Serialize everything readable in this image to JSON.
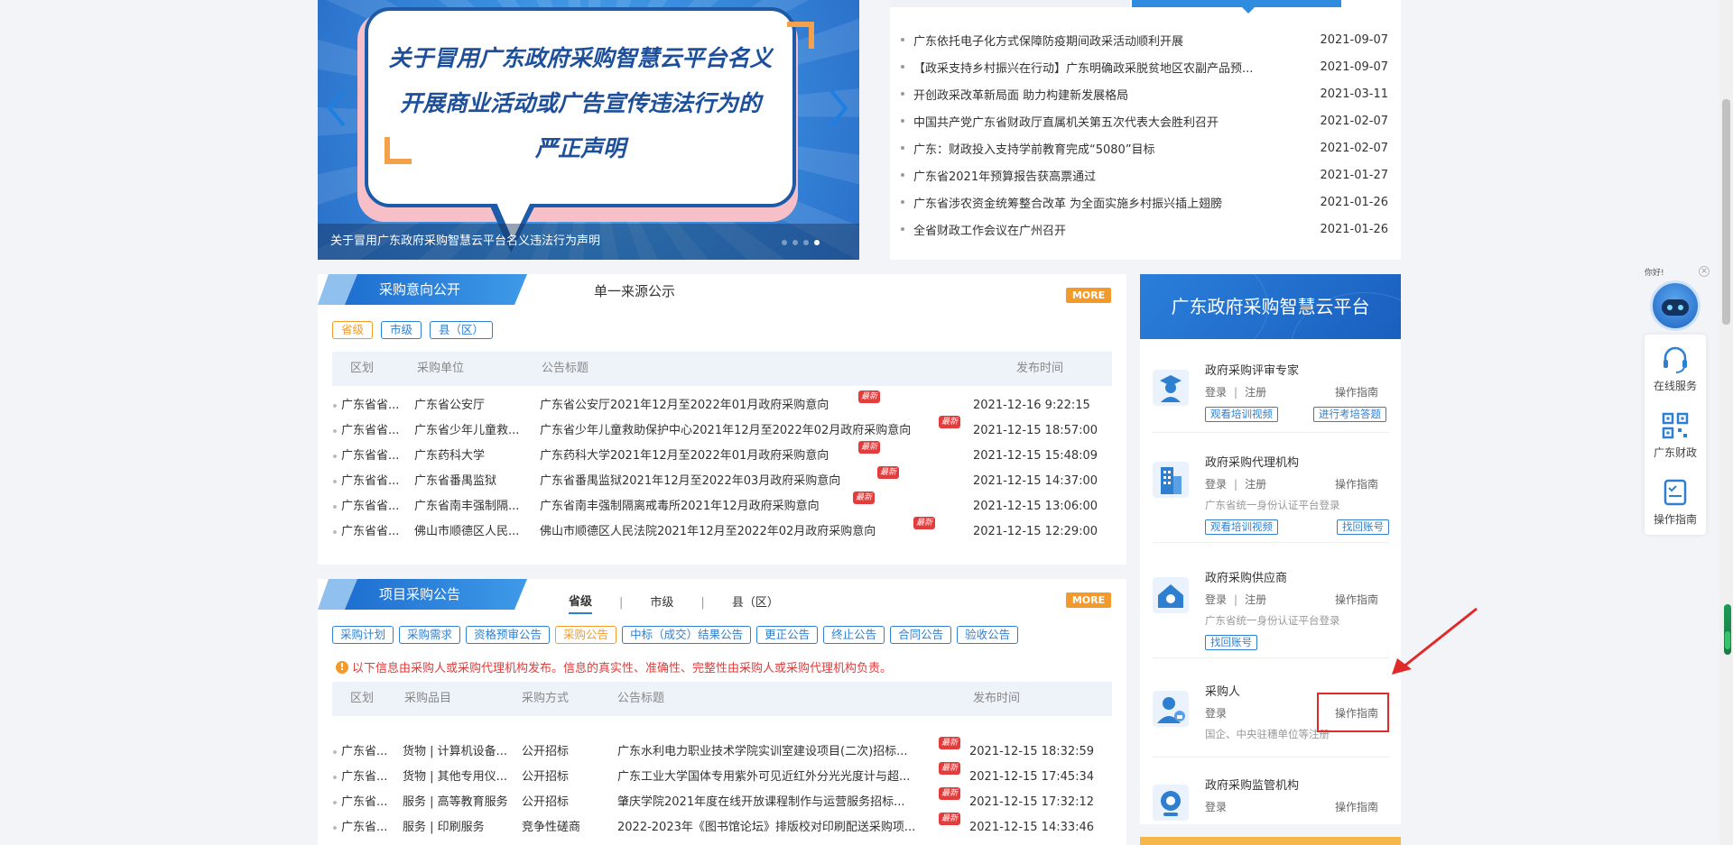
{
  "banner": {
    "headline_lines": [
      "关于冒用广东政府采购智慧云平台名义",
      "开展商业活动或广告宣传违法行为的",
      "严正声明"
    ],
    "caption": "关于冒用广东政府采购智慧云平台名义违法行为声明"
  },
  "news": {
    "items": [
      {
        "title": "广东依托电子化方式保障防疫期间政采活动顺利开展",
        "date": "2021-09-07"
      },
      {
        "title": "【政采支持乡村振兴在行动】广东明确政采脱贫地区农副产品预...",
        "date": "2021-09-07"
      },
      {
        "title": "开创政采改革新局面 助力构建新发展格局",
        "date": "2021-03-11"
      },
      {
        "title": "中国共产党广东省财政厅直属机关第五次代表大会胜利召开",
        "date": "2021-02-07"
      },
      {
        "title": "广东：财政投入支持学前教育完成“5080”目标",
        "date": "2021-02-07"
      },
      {
        "title": "广东省2021年预算报告获高票通过",
        "date": "2021-01-27"
      },
      {
        "title": "广东省涉农资金统筹整合改革 为全面实施乡村振兴插上翅膀",
        "date": "2021-01-26"
      },
      {
        "title": "全省财政工作会议在广州召开",
        "date": "2021-01-26"
      }
    ]
  },
  "intent": {
    "tab_active": "采购意向公开",
    "tab_other": "单一来源公示",
    "more": "MORE",
    "levels": [
      "省级",
      "市级",
      "县（区）"
    ],
    "headers": [
      "区划",
      "采购单位",
      "公告标题",
      "发布时间"
    ],
    "new_tag": "最新",
    "rows": [
      {
        "region": "广东省省...",
        "unit": "广东省公安厅",
        "title": "广东省公安厅2021年12月至2022年01月政府采购意向",
        "time": "2021-12-16 9:22:15"
      },
      {
        "region": "广东省省...",
        "unit": "广东省少年儿童救...",
        "title": "广东省少年儿童救助保护中心2021年12月至2022年02月政府采购意向",
        "time": "2021-12-15 18:57:00"
      },
      {
        "region": "广东省省...",
        "unit": "广东药科大学",
        "title": "广东药科大学2021年12月至2022年01月政府采购意向",
        "time": "2021-12-15 15:48:09"
      },
      {
        "region": "广东省省...",
        "unit": "广东省番禺监狱",
        "title": "广东省番禺监狱2021年12月至2022年03月政府采购意向",
        "time": "2021-12-15 14:37:00"
      },
      {
        "region": "广东省省...",
        "unit": "广东省南丰强制隔...",
        "title": "广东省南丰强制隔离戒毒所2021年12月政府采购意向",
        "time": "2021-12-15 13:06:00"
      },
      {
        "region": "广东省省...",
        "unit": "佛山市顺德区人民...",
        "title": "佛山市顺德区人民法院2021年12月至2022年02月政府采购意向",
        "time": "2021-12-15 12:29:00"
      }
    ]
  },
  "project": {
    "tab": "项目采购公告",
    "more": "MORE",
    "levels": [
      "省级",
      "市级",
      "县（区）"
    ],
    "types": [
      "采购计划",
      "采购需求",
      "资格预审公告",
      "采购公告",
      "中标（成交）结果公告",
      "更正公告",
      "终止公告",
      "合同公告",
      "验收公告"
    ],
    "active_type": "采购公告",
    "notice": "以下信息由采购人或采购代理机构发布。信息的真实性、准确性、完整性由采购人或采购代理机构负责。",
    "headers": [
      "区划",
      "采购品目",
      "采购方式",
      "公告标题",
      "发布时间"
    ],
    "new_tag": "最新",
    "rows": [
      {
        "region": "广东省...",
        "item": "货物 | 计算机设备...",
        "method": "公开招标",
        "title": "广东水利电力职业技术学院实训室建设项目(二次)招标...",
        "time": "2021-12-15 18:32:59"
      },
      {
        "region": "广东省...",
        "item": "货物 | 其他专用仪...",
        "method": "公开招标",
        "title": "广东工业大学国体专用紫外可见近红外分光光度计与超...",
        "time": "2021-12-15 17:45:34"
      },
      {
        "region": "广东省...",
        "item": "服务 | 高等教育服务",
        "method": "公开招标",
        "title": "肇庆学院2021年度在线开放课程制作与运营服务招标...",
        "time": "2021-12-15 17:32:12"
      },
      {
        "region": "广东省...",
        "item": "服务 | 印刷服务",
        "method": "竞争性磋商",
        "title": "2022-2023年《图书馆论坛》排版校对印刷配送采购项...",
        "time": "2021-12-15 14:33:46"
      }
    ]
  },
  "platform": {
    "title": "广东政府采购智慧云平台",
    "login": "登录",
    "register": "注册",
    "sep": "|",
    "guide": "操作指南",
    "roles": [
      {
        "name": "政府采购评审专家",
        "buttons": [
          "观看培训视频",
          "进行考培答题"
        ]
      },
      {
        "name": "政府采购代理机构",
        "note": "广东省统一身份认证平台登录",
        "buttons": [
          "观看培训视频",
          "找回账号"
        ]
      },
      {
        "name": "政府采购供应商",
        "note": "广东省统一身份认证平台登录",
        "buttons": [
          "找回账号"
        ]
      },
      {
        "name": "采购人",
        "note": "国企、中央驻穗单位等注册"
      },
      {
        "name": "政府采购监管机构"
      }
    ]
  },
  "floatbar": {
    "hello": "你好!",
    "close": "×",
    "items": [
      "在线服务",
      "广东财政",
      "操作指南"
    ]
  },
  "colors": {
    "accent": "#2f7fd0",
    "orange": "#f39a2c",
    "highlight": "#e02a2a"
  }
}
